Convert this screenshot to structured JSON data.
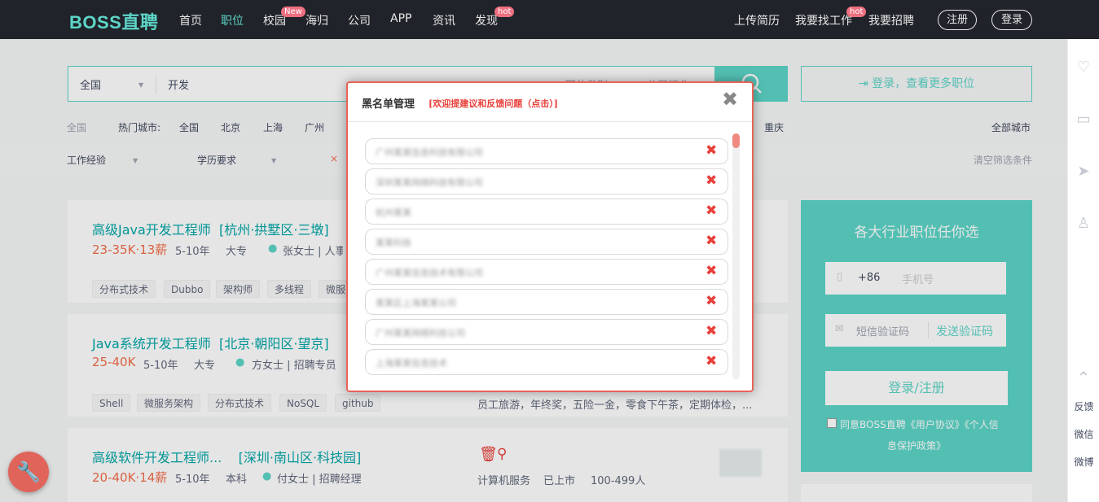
{
  "header": {
    "logo": "BOSS直聘",
    "nav": [
      "首页",
      "职位",
      "校园",
      "海归",
      "公司",
      "APP",
      "资讯",
      "发现"
    ],
    "badge_new": "New",
    "badge_hot": "hot",
    "right": {
      "upload": "上传简历",
      "find_job": "我要找工作",
      "hire": "我要招聘",
      "register": "注册",
      "login": "登录"
    }
  },
  "search": {
    "city": "全国",
    "query": "开发",
    "frag1": "职位类别",
    "frag2": "公司行业",
    "login_prompt": "登录，查看更多职位"
  },
  "hot_cities": {
    "all": "全国",
    "label": "热门城市:",
    "cities": [
      "全国",
      "北京",
      "上海",
      "广州"
    ],
    "extra": "重庆",
    "all_cities": "全部城市"
  },
  "filters": {
    "experience": "工作经验",
    "education": "学历要求",
    "clear": "清空筛选条件"
  },
  "jobs": [
    {
      "title": "高级Java开发工程师",
      "location": "[杭州·拱墅区·三墩]",
      "salary": "23-35K·13薪",
      "exp": "5-10年",
      "edu": "大专",
      "recruiter": "张女士 | 人事行",
      "tags": [
        "分布式技术",
        "Dubbo",
        "架构师",
        "多线程",
        "微服"
      ]
    },
    {
      "title": "Java系统开发工程师",
      "location": "[北京·朝阳区·望京]",
      "salary": "25-40K",
      "exp": "5-10年",
      "edu": "大专",
      "recruiter": "方女士 | 招聘专员",
      "tags": [
        "Shell",
        "微服务架构",
        "分布式技术",
        "NoSQL",
        "github"
      ],
      "benefits": "员工旅游，年终奖，五险一金，零食下午茶，定期体检，..."
    },
    {
      "title": "高级软件开发工程师...",
      "location": "[深圳·南山区·科技园]",
      "salary": "20-40K·14薪",
      "exp": "5-10年",
      "edu": "本科",
      "recruiter": "付女士 | 招聘经理",
      "company_info": [
        "计算机服务",
        "已上市",
        "100-499人"
      ]
    }
  ],
  "right_panel": {
    "title": "各大行业职位任你选",
    "country_code": "+86",
    "phone_placeholder": "手机号",
    "sms_placeholder": "短信验证码",
    "send_code": "发送验证码",
    "login_button": "登录/注册",
    "agree_line1": "同意BOSS直聘《用户协议》《个人信",
    "agree_line2": "息保护政策》"
  },
  "sidebar": {
    "feedback": "反馈",
    "wechat": "微信",
    "weibo": "微博"
  },
  "modal": {
    "title": "黑名单管理",
    "link": "[欢迎提建议和反馈问题（点击）]",
    "close": "✖",
    "items": [
      "广州某某信息科技有限公司",
      "深圳某某网络科技有限公司",
      "杭州某某",
      "某某科技",
      "广州某某信息技术有限公司",
      "某某区上海某某公司",
      "广州某某网络科技公司",
      "上海某某信息技术"
    ]
  },
  "colors": {
    "accent": "#5dd5c8",
    "danger": "#e8403a",
    "salary": "#f26d49"
  }
}
